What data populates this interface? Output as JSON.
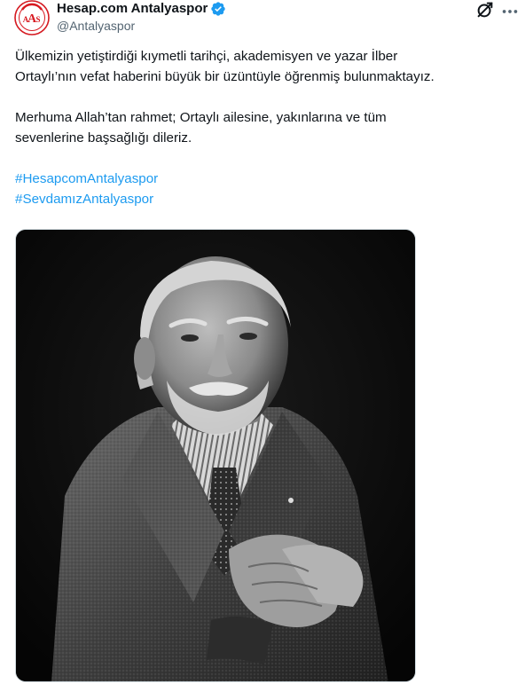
{
  "author": {
    "display_name": "Hesap.com Antalyaspor",
    "handle": "@Antalyaspor",
    "verified": true,
    "avatar_logo": "Antalyaspor club crest",
    "verified_color": "#1d9bf0"
  },
  "header_actions": {
    "grok_icon": "grok-icon",
    "more_icon": "more-dots-icon"
  },
  "tweet": {
    "paragraph_1": "Ülkemizin yetiştirdiği kıymetli tarihçi, akademisyen ve yazar İlber Ortaylı’nın vefat haberini büyük bir üzüntüyle öğrenmiş bulunmaktayız.",
    "paragraph_1_line_1": "Ülkemizin yetiştirdiği kıymetli tarihçi, akademisyen ve yazar İlber",
    "paragraph_1_line_2": "Ortaylı’nın vefat haberini büyük bir üzüntüyle öğrenmiş bulunmaktayız.",
    "paragraph_2_line_1": "Merhuma Allah’tan rahmet; Ortaylı ailesine, yakınlarına ve tüm",
    "paragraph_2_line_2": "sevenlerine başsağlığı dileriz.",
    "hashtags": [
      "#HesapcomAntalyaspor",
      "#SevdamızAntalyaspor"
    ],
    "link_color": "#1d9bf0"
  },
  "media": {
    "kind": "black-and-white portrait photo"
  }
}
